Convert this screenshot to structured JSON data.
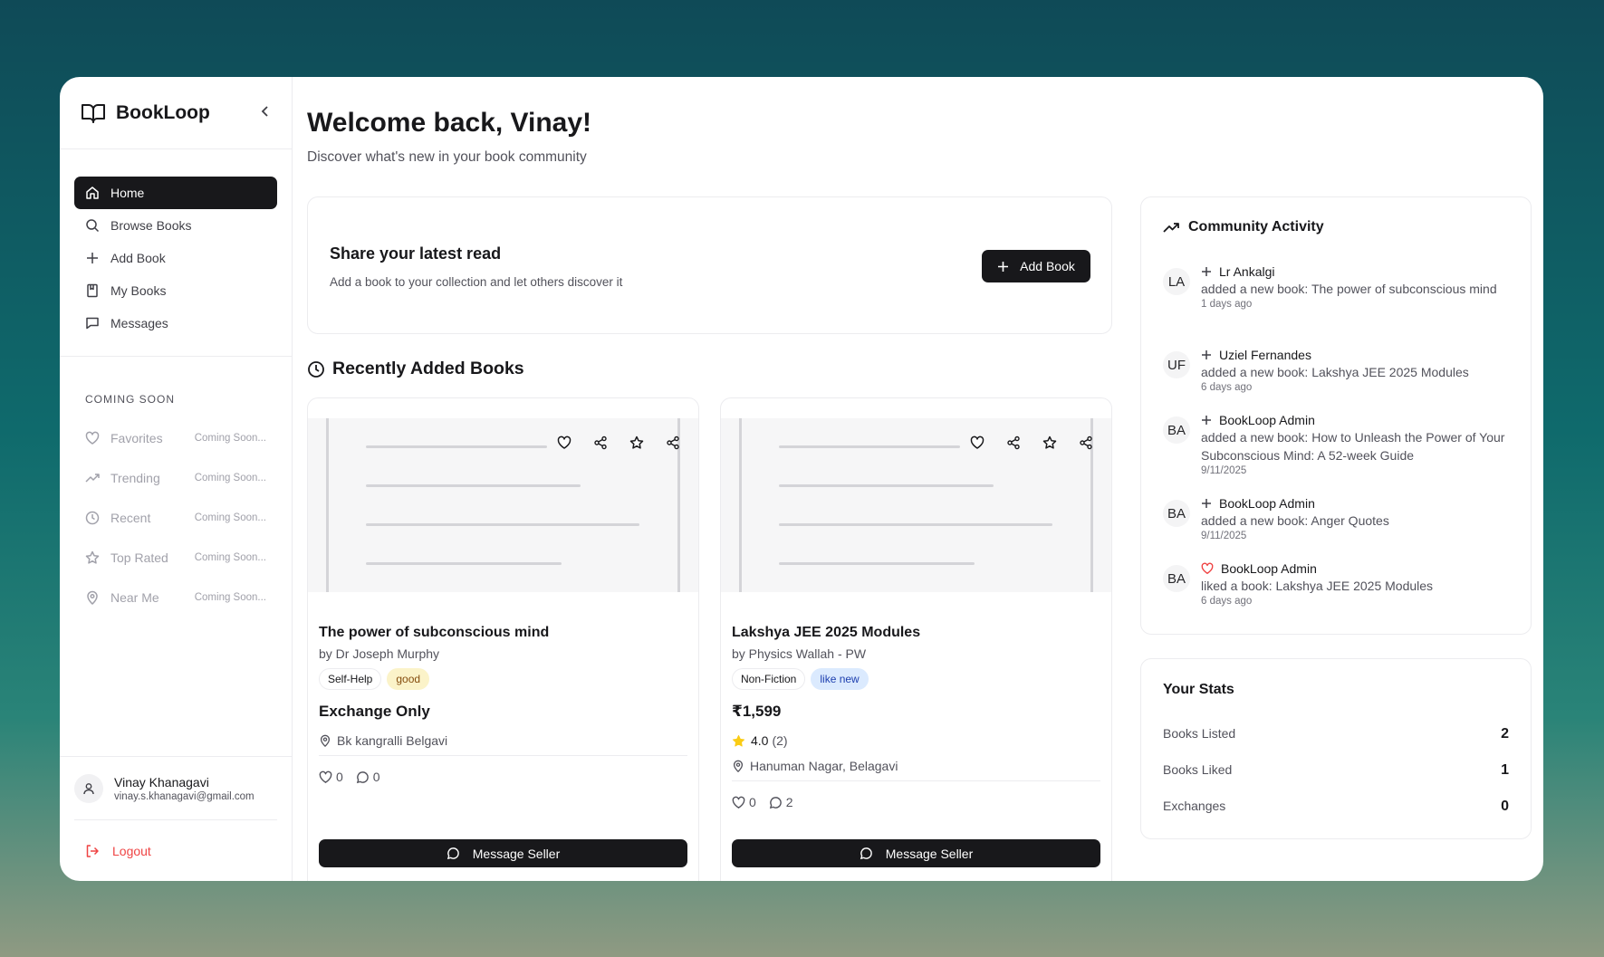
{
  "app": {
    "name": "BookLoop"
  },
  "nav": [
    {
      "label": "Home",
      "icon": "home-icon"
    },
    {
      "label": "Browse Books",
      "icon": "search-icon"
    },
    {
      "label": "Add Book",
      "icon": "plus-icon"
    },
    {
      "label": "My Books",
      "icon": "book-icon"
    },
    {
      "label": "Messages",
      "icon": "message-icon"
    }
  ],
  "coming_soon": {
    "title": "COMING SOON",
    "items": [
      {
        "label": "Favorites",
        "tag": "Coming Soon..."
      },
      {
        "label": "Trending",
        "tag": "Coming Soon..."
      },
      {
        "label": "Recent",
        "tag": "Coming Soon..."
      },
      {
        "label": "Top Rated",
        "tag": "Coming Soon..."
      },
      {
        "label": "Near Me",
        "tag": "Coming Soon..."
      }
    ]
  },
  "user": {
    "name": "Vinay Khanagavi",
    "email": "vinay.s.khanagavi@gmail.com"
  },
  "logout_label": "Logout",
  "header": {
    "title": "Welcome back, Vinay!",
    "subtitle": "Discover what's new in your book community"
  },
  "share": {
    "title": "Share your latest read",
    "subtitle": "Add a book to your collection and let others discover it",
    "button": "Add Book"
  },
  "recent": {
    "title": "Recently Added Books",
    "books": [
      {
        "title": "The power of subconscious mind",
        "author": "by Dr Joseph Murphy",
        "genre": "Self-Help",
        "condition": "good",
        "price": "Exchange Only",
        "location": "Bk kangralli Belgavi",
        "likes": "0",
        "comments": "0",
        "button": "Message Seller"
      },
      {
        "title": "Lakshya JEE 2025 Modules",
        "author": "by Physics Wallah - PW",
        "genre": "Non-Fiction",
        "condition": "like new",
        "price": "₹1,599",
        "rating": "4.0",
        "rating_count": "(2)",
        "location": "Hanuman Nagar, Belagavi",
        "likes": "0",
        "comments": "2",
        "button": "Message Seller"
      }
    ]
  },
  "activity": {
    "title": "Community Activity",
    "items": [
      {
        "initials": "LA",
        "user": "Lr Ankalgi",
        "type": "add",
        "text": "added a new book: The power of subconscious mind",
        "time": "1 days ago"
      },
      {
        "initials": "UF",
        "user": "Uziel Fernandes",
        "type": "add",
        "text": "added a new book: Lakshya JEE 2025 Modules",
        "time": "6 days ago"
      },
      {
        "initials": "BA",
        "user": "BookLoop Admin",
        "type": "add",
        "text": "added a new book: How to Unleash the Power of Your Subconscious Mind: A 52-week Guide",
        "time": "9/11/2025"
      },
      {
        "initials": "BA",
        "user": "BookLoop Admin",
        "type": "add",
        "text": "added a new book: Anger Quotes",
        "time": "9/11/2025"
      },
      {
        "initials": "BA",
        "user": "BookLoop Admin",
        "type": "like",
        "text": "liked a book: Lakshya JEE 2025 Modules",
        "time": "6 days ago"
      }
    ]
  },
  "stats": {
    "title": "Your Stats",
    "rows": [
      {
        "label": "Books Listed",
        "value": "2"
      },
      {
        "label": "Books Liked",
        "value": "1"
      },
      {
        "label": "Exchanges",
        "value": "0"
      }
    ]
  },
  "colors": {
    "primary": "#18181b",
    "danger": "#ef4444",
    "star": "#facc15",
    "like": "#ef4444"
  }
}
